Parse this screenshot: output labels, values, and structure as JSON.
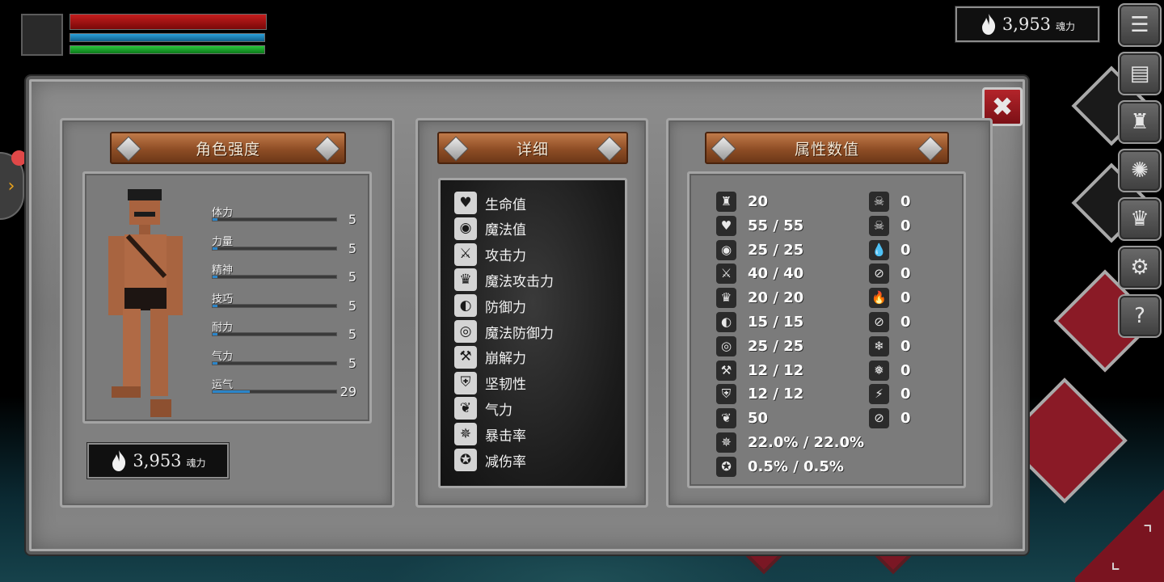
{
  "soul": {
    "amount": "3,953",
    "unit": "魂力"
  },
  "panels": {
    "character": "角色强度",
    "detail": "详细",
    "attributes": "属性数值"
  },
  "stats": [
    {
      "label": "体力",
      "value": "5",
      "level": 0.04
    },
    {
      "label": "力量",
      "value": "5",
      "level": 0.04
    },
    {
      "label": "精神",
      "value": "5",
      "level": 0.04
    },
    {
      "label": "技巧",
      "value": "5",
      "level": 0.04
    },
    {
      "label": "耐力",
      "value": "5",
      "level": 0.04
    },
    {
      "label": "气力",
      "value": "5",
      "level": 0.04
    },
    {
      "label": "运气",
      "value": "29",
      "level": 0.3
    }
  ],
  "details": [
    {
      "label": "生命值",
      "icon": "heart-icon",
      "glyph": "♥"
    },
    {
      "label": "魔法值",
      "icon": "head-icon",
      "glyph": "◉"
    },
    {
      "label": "攻击力",
      "icon": "sword-icon",
      "glyph": "⚔"
    },
    {
      "label": "魔法攻击力",
      "icon": "crown-icon",
      "glyph": "♛"
    },
    {
      "label": "防御力",
      "icon": "shield-icon",
      "glyph": "◐"
    },
    {
      "label": "魔法防御力",
      "icon": "magic-shield-icon",
      "glyph": "◎"
    },
    {
      "label": "崩解力",
      "icon": "hammer-icon",
      "glyph": "⚒"
    },
    {
      "label": "坚韧性",
      "icon": "helmet-icon",
      "glyph": "⛨"
    },
    {
      "label": "气力",
      "icon": "lungs-icon",
      "glyph": "❦"
    },
    {
      "label": "暴击率",
      "icon": "burst-icon",
      "glyph": "✵"
    },
    {
      "label": "减伤率",
      "icon": "badge-icon",
      "glyph": "✪"
    }
  ],
  "attributes_left": [
    {
      "value": "20",
      "icon": "armor-icon",
      "glyph": "♜"
    },
    {
      "value": "55 / 55",
      "icon": "heart-icon",
      "glyph": "♥"
    },
    {
      "value": "25 / 25",
      "icon": "head-icon",
      "glyph": "◉"
    },
    {
      "value": "40 / 40",
      "icon": "sword-icon",
      "glyph": "⚔"
    },
    {
      "value": "20 / 20",
      "icon": "crown-icon",
      "glyph": "♛"
    },
    {
      "value": "15 / 15",
      "icon": "shield-icon",
      "glyph": "◐"
    },
    {
      "value": "25 / 25",
      "icon": "magic-shield-icon",
      "glyph": "◎"
    },
    {
      "value": "12 / 12",
      "icon": "hammer-icon",
      "glyph": "⚒"
    },
    {
      "value": "12 / 12",
      "icon": "helmet-icon",
      "glyph": "⛨"
    },
    {
      "value": "50",
      "icon": "lungs-icon",
      "glyph": "❦"
    },
    {
      "value": "22.0% / 22.0%",
      "icon": "burst-icon",
      "glyph": "✵"
    },
    {
      "value": "0.5% / 0.5%",
      "icon": "badge-icon",
      "glyph": "✪"
    }
  ],
  "attributes_right": [
    {
      "value": "0",
      "icon": "skull-icon",
      "glyph": "☠"
    },
    {
      "value": "0",
      "icon": "skull-resist-icon",
      "glyph": "☠"
    },
    {
      "value": "0",
      "icon": "drop-icon",
      "glyph": "💧"
    },
    {
      "value": "0",
      "icon": "drop-resist-icon",
      "glyph": "⊘"
    },
    {
      "value": "0",
      "icon": "fire-icon",
      "glyph": "🔥"
    },
    {
      "value": "0",
      "icon": "fire-resist-icon",
      "glyph": "⊘"
    },
    {
      "value": "0",
      "icon": "snowflake-icon",
      "glyph": "❄"
    },
    {
      "value": "0",
      "icon": "snowflake-resist-icon",
      "glyph": "❅"
    },
    {
      "value": "0",
      "icon": "lightning-icon",
      "glyph": "⚡"
    },
    {
      "value": "0",
      "icon": "lightning-resist-icon",
      "glyph": "⊘"
    }
  ],
  "menu": [
    {
      "icon": "menu-list-icon",
      "glyph": "☰"
    },
    {
      "icon": "map-icon",
      "glyph": "▤"
    },
    {
      "icon": "armor-menu-icon",
      "glyph": "♜"
    },
    {
      "icon": "rune-icon",
      "glyph": "✺"
    },
    {
      "icon": "crown-menu-icon",
      "glyph": "♛"
    },
    {
      "icon": "settings-icon",
      "glyph": "⚙"
    },
    {
      "icon": "help-icon",
      "glyph": "?"
    }
  ],
  "close_glyph": "✖",
  "expand_glyph": "›"
}
